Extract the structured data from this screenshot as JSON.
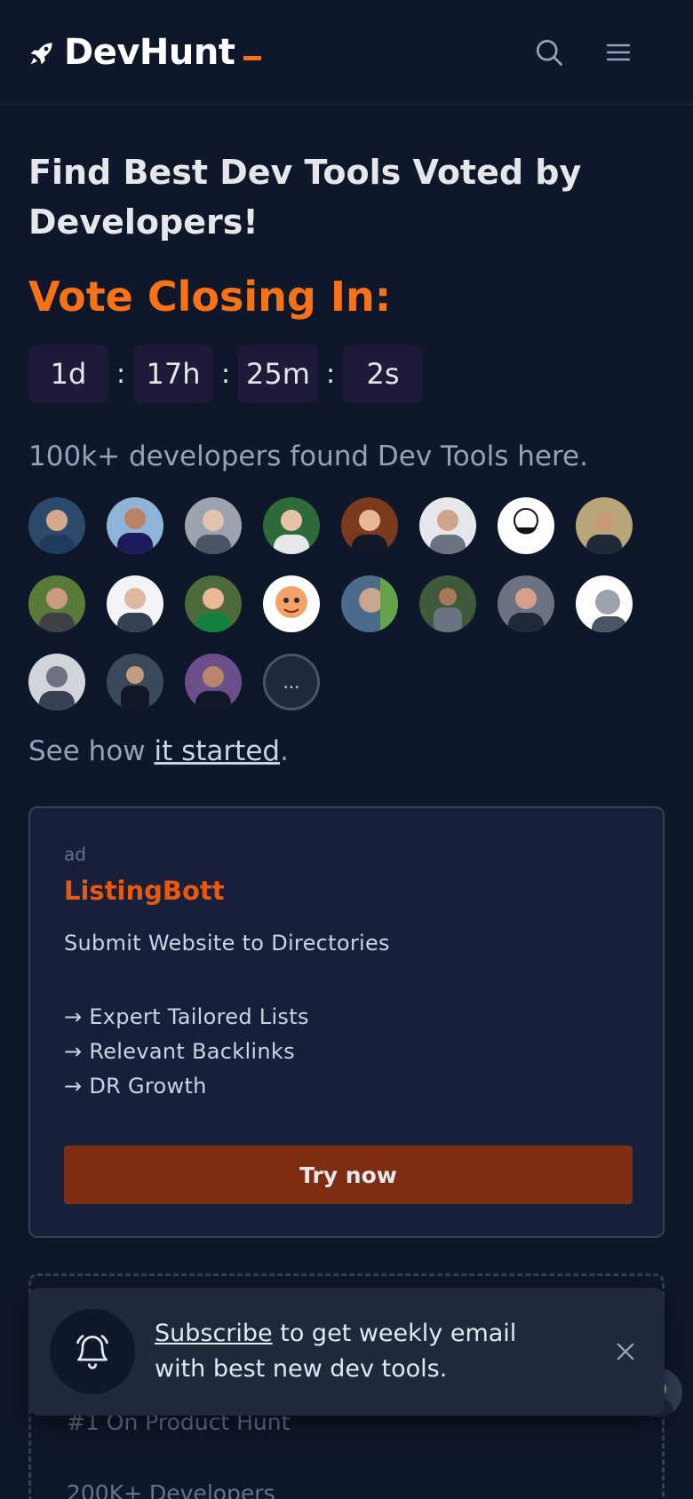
{
  "header": {
    "logo_text": "DevHunt",
    "search_icon": "search-icon",
    "menu_icon": "hamburger-menu-icon"
  },
  "hero": {
    "title": "Find Best Dev Tools Voted by Developers!",
    "vote_title": "Vote Closing In:",
    "countdown": {
      "days": "1d",
      "hours": "17h",
      "minutes": "25m",
      "seconds": "2s",
      "separator": ":"
    },
    "found_text": "100k+ developers found Dev Tools here.",
    "more_label": "...",
    "started_prefix": "See how ",
    "started_link": "it started",
    "started_suffix": "."
  },
  "ad": {
    "tag": "ad",
    "title": "ListingBott",
    "description": "Submit Website to Directories",
    "features": [
      "→ Expert Tailored Lists",
      "→ Relevant Backlinks",
      "→ DR Growth"
    ],
    "cta": "Try now"
  },
  "dashed_card": {
    "line1": "#1 On Product Hunt",
    "line2": "200K+ Developers"
  },
  "toast": {
    "link": "Subscribe",
    "text": " to get weekly email with best new dev tools."
  },
  "colors": {
    "background": "#0f172a",
    "accent": "#f97316",
    "button": "#7c2d12"
  }
}
